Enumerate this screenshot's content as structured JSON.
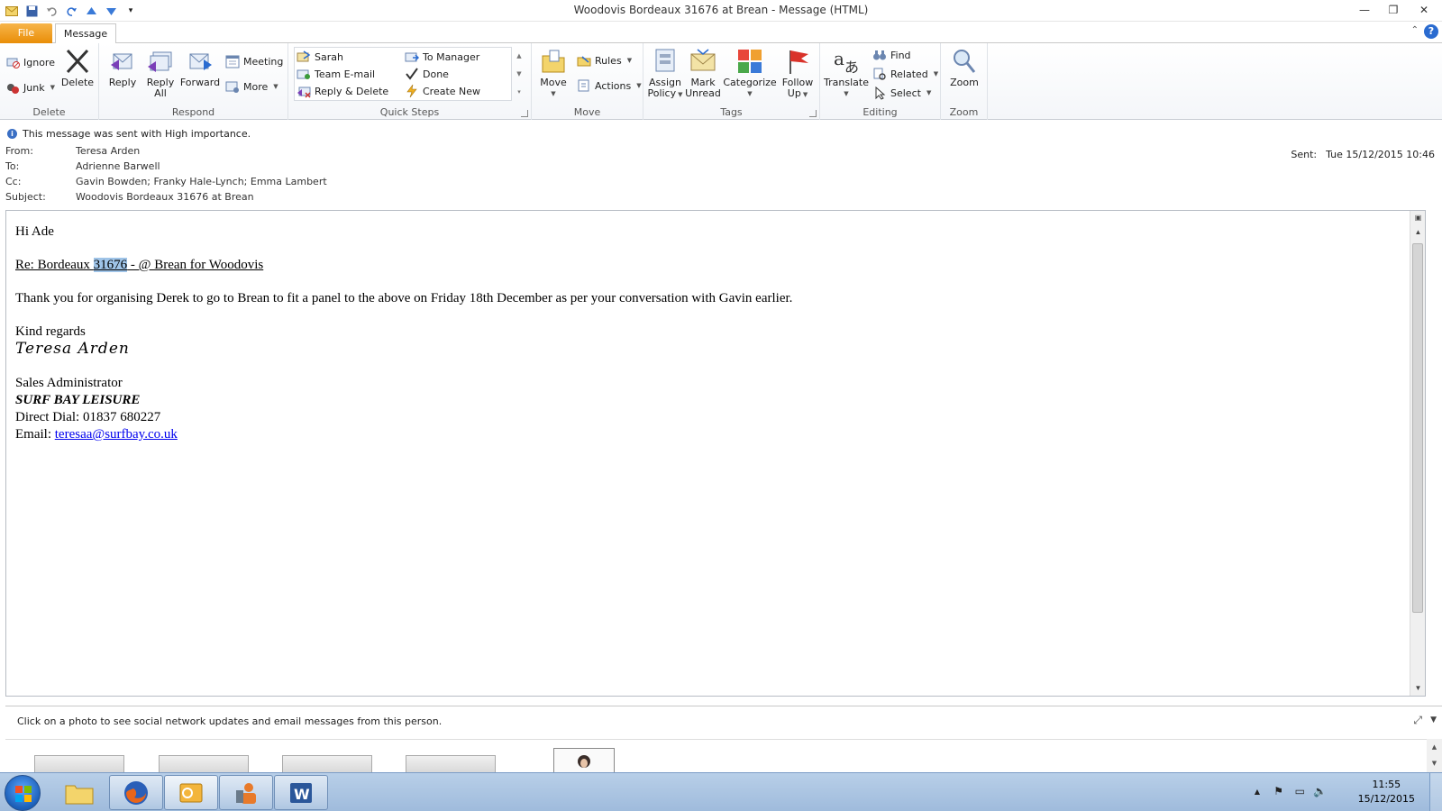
{
  "window": {
    "title": "Woodovis Bordeaux 31676 at Brean  -  Message (HTML)"
  },
  "tabs": {
    "file": "File",
    "message": "Message"
  },
  "ribbon": {
    "delete": {
      "ignore": "Ignore",
      "junk": "Junk",
      "delete": "Delete",
      "label": "Delete"
    },
    "respond": {
      "reply": "Reply",
      "reply_all_1": "Reply",
      "reply_all_2": "All",
      "forward": "Forward",
      "meeting": "Meeting",
      "more": "More",
      "label": "Respond"
    },
    "quick_steps": {
      "items": [
        "Sarah",
        "To Manager",
        "Team E-mail",
        "Done",
        "Reply & Delete",
        "Create New"
      ],
      "label": "Quick Steps"
    },
    "move": {
      "move": "Move",
      "rules": "Rules",
      "actions": "Actions",
      "label": "Move"
    },
    "tags": {
      "assign_1": "Assign",
      "assign_2": "Policy",
      "mark_1": "Mark",
      "mark_2": "Unread",
      "categorize": "Categorize",
      "follow_1": "Follow",
      "follow_2": "Up",
      "label": "Tags"
    },
    "editing": {
      "translate": "Translate",
      "find": "Find",
      "related": "Related",
      "select": "Select",
      "label": "Editing"
    },
    "zoom": {
      "zoom": "Zoom",
      "label": "Zoom"
    }
  },
  "header": {
    "importance": "This message was sent with High importance.",
    "from_label": "From:",
    "from": "Teresa Arden",
    "to_label": "To:",
    "to": "Adrienne Barwell",
    "cc_label": "Cc:",
    "cc": "Gavin Bowden; Franky Hale-Lynch; Emma Lambert",
    "subject_label": "Subject:",
    "subject": "Woodovis Bordeaux 31676 at Brean",
    "sent_label": "Sent:",
    "sent": "Tue 15/12/2015 10:46"
  },
  "body": {
    "greeting": "Hi Ade",
    "re_prefix": "Re:  Bordeaux ",
    "re_number": "31676",
    "re_suffix": " - @ Brean for Woodovis",
    "paragraph": "Thank you for organising Derek to go to Brean to fit a panel to the above on Friday 18th December as per your conversation with Gavin earlier.",
    "closing": "Kind regards",
    "signature": "Teresa Arden",
    "title": "Sales Administrator",
    "company": "SURF BAY LEISURE",
    "dial_label": "Direct Dial:  ",
    "dial": "01837 680227",
    "email_label": "Email:  ",
    "email": "teresaa@surfbay.co.uk"
  },
  "people_pane": {
    "text": "Click on a photo to see social network updates and email messages from this person."
  },
  "taskbar": {
    "time": "11:55",
    "date": "15/12/2015"
  },
  "colors": {
    "file_tab": "#e98d07",
    "link": "#0000ee",
    "highlight": "#9fc4e8",
    "taskbar": "#9fbbdc"
  }
}
